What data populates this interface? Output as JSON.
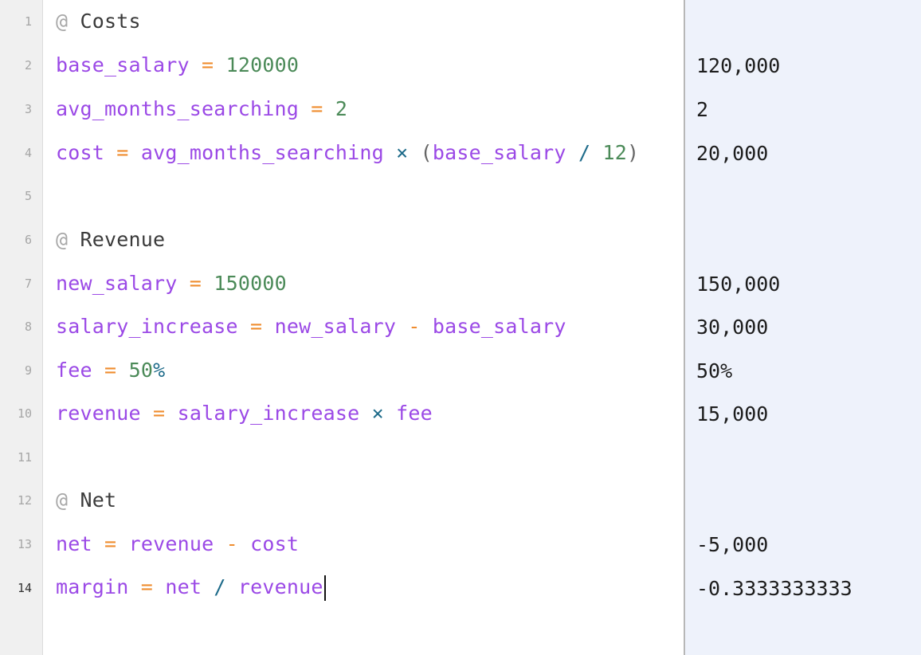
{
  "line_numbers": [
    "1",
    "2",
    "3",
    "4",
    "5",
    "6",
    "7",
    "8",
    "9",
    "10",
    "11",
    "12",
    "13",
    "14"
  ],
  "active_line": "14",
  "editor": {
    "lines": [
      {
        "tokens": [
          "@",
          "Costs"
        ]
      },
      {
        "tokens": [
          "base_salary",
          "=",
          "120000"
        ]
      },
      {
        "tokens": [
          "avg_months_searching",
          "=",
          "2"
        ]
      },
      {
        "tokens": [
          "cost",
          "=",
          "avg_months_searching",
          "×",
          "(",
          "base_salary",
          "/",
          "12",
          ")"
        ]
      },
      {
        "tokens": []
      },
      {
        "tokens": [
          "@",
          "Revenue"
        ]
      },
      {
        "tokens": [
          "new_salary",
          "=",
          "150000"
        ]
      },
      {
        "tokens": [
          "salary_increase",
          "=",
          "new_salary",
          "-",
          "base_salary"
        ]
      },
      {
        "tokens": [
          "fee",
          "=",
          "50",
          "%"
        ]
      },
      {
        "tokens": [
          "revenue",
          "=",
          "salary_increase",
          "×",
          "fee"
        ]
      },
      {
        "tokens": []
      },
      {
        "tokens": [
          "@",
          "Net"
        ]
      },
      {
        "tokens": [
          "net",
          "=",
          "revenue",
          "-",
          "cost"
        ]
      },
      {
        "tokens": [
          "margin",
          "=",
          "net",
          "/",
          "revenue"
        ]
      }
    ]
  },
  "results": {
    "line2": "120,000",
    "line3": "2",
    "line4": "20,000",
    "line7": "150,000",
    "line8": "30,000",
    "line9": "50%",
    "line10": "15,000",
    "line13": "-5,000",
    "line14": "-0.3333333333"
  },
  "colors": {
    "variable": "#9b49e6",
    "number": "#4b8a58",
    "operator": "#ef8d2f",
    "multiply_divide": "#1e6b8a",
    "results_background": "#eef2fb",
    "gutter_background": "#f0f0f0"
  }
}
